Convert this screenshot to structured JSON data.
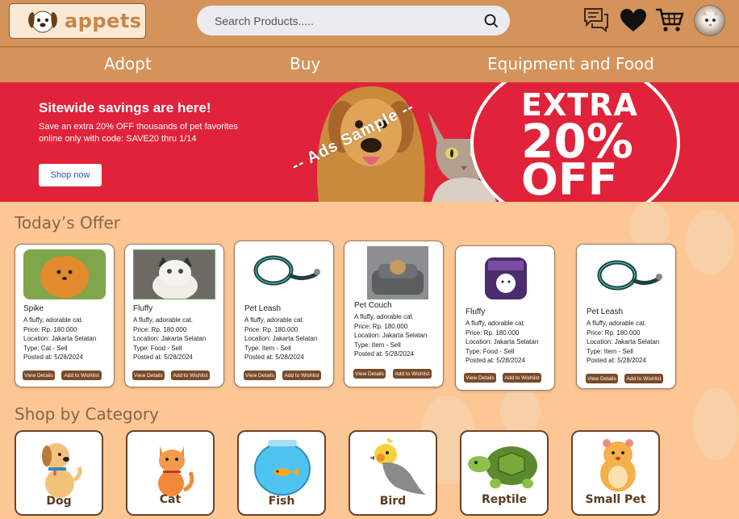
{
  "header": {
    "logo_text": "appets",
    "search_placeholder": "Search Products.....",
    "icons": [
      "chat-icon",
      "heart-icon",
      "cart-icon",
      "avatar"
    ]
  },
  "nav": {
    "items": [
      {
        "label": "Adopt"
      },
      {
        "label": "Buy"
      },
      {
        "label": "Equipment and Food"
      }
    ]
  },
  "banner": {
    "headline": "Sitewide savings are here!",
    "subtext": "Save an extra 20% OFF thousands of pet favorites online only with code: SAVE20 thru 1/14",
    "button": "Shop now",
    "extra": "EXTRA",
    "percent": "20%",
    "off": "OFF",
    "watermark": "-- Ads Sample --"
  },
  "offers": {
    "title": "Today’s Offer",
    "view_label": "View Details",
    "wish_label": "Add to Wishlist",
    "items": [
      {
        "name": "Spike",
        "desc": "A fluffy, adorable cat.",
        "price": "Price: Rp. 180.000",
        "location": "Location: Jakarta Selatan",
        "type": "Type: Cat - Sell",
        "posted": "Posted at: 5/28/2024"
      },
      {
        "name": "Fluffy",
        "desc": "A fluffy, adorable cat.",
        "price": "Price: Rp. 180.000",
        "location": "Location: Jakarta Selatan",
        "type": "Type: Food - Sell",
        "posted": "Posted at: 5/28/2024"
      },
      {
        "name": "Pet Leash",
        "desc": "A fluffy, adorable cat.",
        "price": "Price: Rp. 180.000",
        "location": "Location: Jakarta Selatan",
        "type": "Type: Item - Sell",
        "posted": "Posted at: 5/28/2024"
      },
      {
        "name": "Pet Couch",
        "desc": "A fluffy, adorable cat.",
        "price": "Price: Rp. 180.000",
        "location": "Location: Jakarta Selatan",
        "type": "Type: Item - Sell",
        "posted": "Posted at: 5/28/2024"
      },
      {
        "name": "Fluffy",
        "desc": "A fluffy, adorable cat.",
        "price": "Price: Rp. 180.000",
        "location": "Location: Jakarta Selatan",
        "type": "Type: Food - Sell",
        "posted": "Posted at: 5/28/2024"
      },
      {
        "name": "Pet Leash",
        "desc": "A fluffy, adorable cat.",
        "price": "Price: Rp. 180.000",
        "location": "Location: Jakarta Selatan",
        "type": "Type: Item - Sell",
        "posted": "Posted at: 5/28/2024"
      }
    ]
  },
  "categories": {
    "title": "Shop by Category",
    "items": [
      {
        "label": "Dog"
      },
      {
        "label": "Cat"
      },
      {
        "label": "Fish"
      },
      {
        "label": "Bird"
      },
      {
        "label": "Reptile"
      },
      {
        "label": "Small Pet"
      }
    ]
  },
  "colors": {
    "header": "#d4935a",
    "background": "#fcc795",
    "banner": "#e0233a",
    "button": "#7a4a28"
  }
}
